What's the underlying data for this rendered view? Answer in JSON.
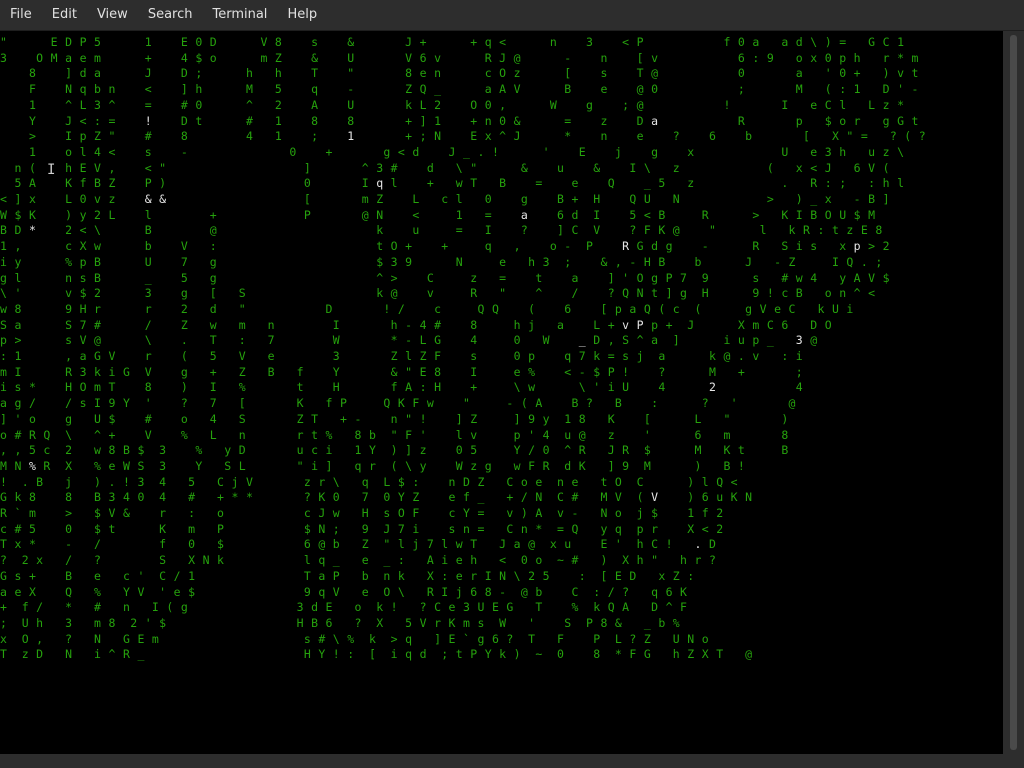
{
  "menubar": {
    "items": [
      "File",
      "Edit",
      "View",
      "Search",
      "Terminal",
      "Help"
    ]
  },
  "colors": {
    "rain_green": "#26a20d",
    "rain_highlight": "#e6e6e6",
    "terminal_bg": "#000000",
    "chrome_bg": "#2d2d2d"
  },
  "icons": {
    "text_cursor": "i-beam-icon"
  },
  "terminal": {
    "lines": [
      "\"      E D P 5      1    E 0 D      V 8    s    &       J +      + q <      n    3    < P           f 0 a   a d \\ ) =   G C 1",
      "3    O M a e m      +    4 $ o      m Z    &    U       V 6 v      R J @      -    n    [ v           6 : 9   o x 0 p h   r * m",
      "    8    ] d a      J    D ;      h   h    T    \"       8 e n      c O z      [    s    T @           0       a   ' 0 +   ) v t",
      "    F    N q b n    <    ] h      M   5    q    -       Z Q _      a A V      B    e    @ 0           ;       M   ( : 1   D ' -",
      "    1    ^ L 3 ^    =    # 0      ^   2    A    U       k L 2    O 0 ,      W    g    ; @           !       I   e C l   L z *",
      "    Y    J < : =    !    D t      #   1    8    8       + ] 1    + n 0 &      =    z    D a           R       p   $ o r   g G t",
      "    >    I p Z \"    #    8        4   1    ;    1       + ; N    E x ^ J      *    n    e    ?    6    b       [   X \" =   ? ( ?",
      "    1    o l 4 <    s    -              0    +       g < d    J _ . !      '    E    j    g    x            U   e 3 h   u z \\",
      "  n (    h E V ,    < \"                   ]       ^ 3 #    d   \\ \"      &    u    &    I \\   z            (   x < J   6 V (",
      "  5 A    K f B Z    P )                   0       I q l    +   w T   B    =    e    Q    _ 5   z            .   R : ;   : h l",
      "< ] x    L 0 v z    & &                   [       m Z    L   c l   0    g    B +  H    Q U   N            >   ) _ x   - B ]",
      "W $ K    ) y 2 L    l        +            P       @ N    <     1   =    a    6 d  I    5 < B     R      >   K I B O U $ M",
      "B D *    2 < \\      B        @                      k    u     =   I    ?    ] C  V    ? F K @    \"      l   k R : t z E 8",
      "1 ,      c X w      b    V   :                      t O +    +     q   ,    o -  P    R G d g    -      R   S i s   x p > 2",
      "i y      % p B      U    7   g                      $ 3 9      N     e   h 3  ;    & , - H B    b      J   - Z     I Q . ;",
      "g l      n s B      _    5   g                      ^ >    C     z   =    t    a    ] ' O g P 7  9      s   # w 4   y A V $",
      "\\ '      v $ 2      3    g   [   S                  k @    v     R   \"    ^    /    ? Q N t ] g  H      9 ! c B   o n ^ <",
      "w 8      9 H r      r    2   d   \"           D       ! /    c     Q Q    (    6    [ p a Q ( c  (      g V e C   k U i",
      "S a      S 7 #      /    Z   w   m   n        I       h - 4 #    8     h j   a    L + v P p +  J      X m C 6   D O",
      "p >      s V @      \\    .   T   :   7        W       * - L G    4     0   W    _ D , S ^ a  ]      i u p _   3 @",
      ": 1      , a G V    r    (   5   V   e        3       Z l Z F    s     0 p    q 7 k = s j  a      k @ . v   : i",
      "m I      R 3 k i G  V    g   +   Z   B   f    Y       & \" E 8    I     e %    < - $ P !    ?      M   +       ;",
      "i s *    H O m T    8    )   I   %       t    H       f A : H    +     \\ w      \\ ' i U    4      2           4",
      "a g /    / s I 9 Y  '    ?   7   [       K   f P     Q K F w    \"     - ( A    B ?   B    :      ?   '       @",
      "] ' o    g   U $    #    o   4   S       Z T   + -    n \" !    ] Z     ] 9 y  1 8   K    [      L   \"       )",
      "o # R Q  \\   ^ +    V    %   L   n       r t %   8 b  \" F '    l v     p ' 4  u @   z    '      6   m       8",
      ", , 5 c  2   w 8 B $  3    %   y D       u c i   1 Y  ) ] z    0 5     Y / 0  ^ R   J R  $      M   K t     B",
      "M N % R  X   % e W S  3    Y   S L       \" i ]   q r  ( \\ y    W z g   w F R  d K   ] 9  M      )   B !",
      "!  . B   j   ) . ! 3  4   5   C j V       z r \\   q  L $ :    n D Z   C o e  n e   t O  C      ) l Q <",
      "G k 8    8   B 3 4 0  4   #   + * *       ? K 0   7  0 Y Z    e f _   + / N  C #   M V  ( V    ) 6 u K N",
      "R ` m    >   $ V &    r   :   o           c J w   H  s O F    c Y =   v ) A  v -   N o  j $    1 f 2",
      "c # 5    0   $ t      K   m   P           $ N ;   9  J 7 i    s n =   C n *  = Q   y q  p r    X < 2",
      "T x *    -   /        f   0   $           6 @ b   Z  \" l j 7 l w T   J a @  x u    E '  h C !   . D",
      "?  2 x   /   ?        S   X N k           l q _   e  _ :   A i e h   <  0 o  ~ #   )  X h \"   h r ?",
      "G s +    B   e   c '  C / 1               T a P   b  n k   X : e r I N \\ 2 5    :  [ E D   x Z :",
      "a e X    Q   %   Y V  ' e $               9 q V   e  O \\   R I j 6 8 -  @ b    C  : / ?   q 6 K",
      "+  f /   *   #   n   I ( g               3 d E   o  k !   ? C e 3 U E G   T    %  k Q A   D ^ F",
      ";  U h   3   m 8  2 ' $                  H B 6   ?  X   5 V r K m s  W   '    S  P 8 &   _ b %",
      "x  O ,   ?   N   G E m                    s # \\ %  k  > q   ] E ` g 6 ?  T   F    P  L ? Z   U N o",
      "T  z D   N   i ^ R _                      H Y ! :  [  i q d  ; t P Y k )  ~  0    8  * F G   h Z X T   @"
    ],
    "highlighted_chars": [
      "o",
      "s",
      "!",
      "t",
      "4",
      "1",
      "0",
      "I",
      "c",
      "L",
      "&",
      "P",
      "@",
      "*",
      "q",
      "3",
      "s",
      "h",
      "j",
      "u",
      "v",
      "R",
      "B",
      "+",
      "i",
      "Q",
      "j",
      "$",
      "C",
      "n",
      "x",
      "j",
      "@",
      "D",
      "M",
      "N"
    ]
  }
}
